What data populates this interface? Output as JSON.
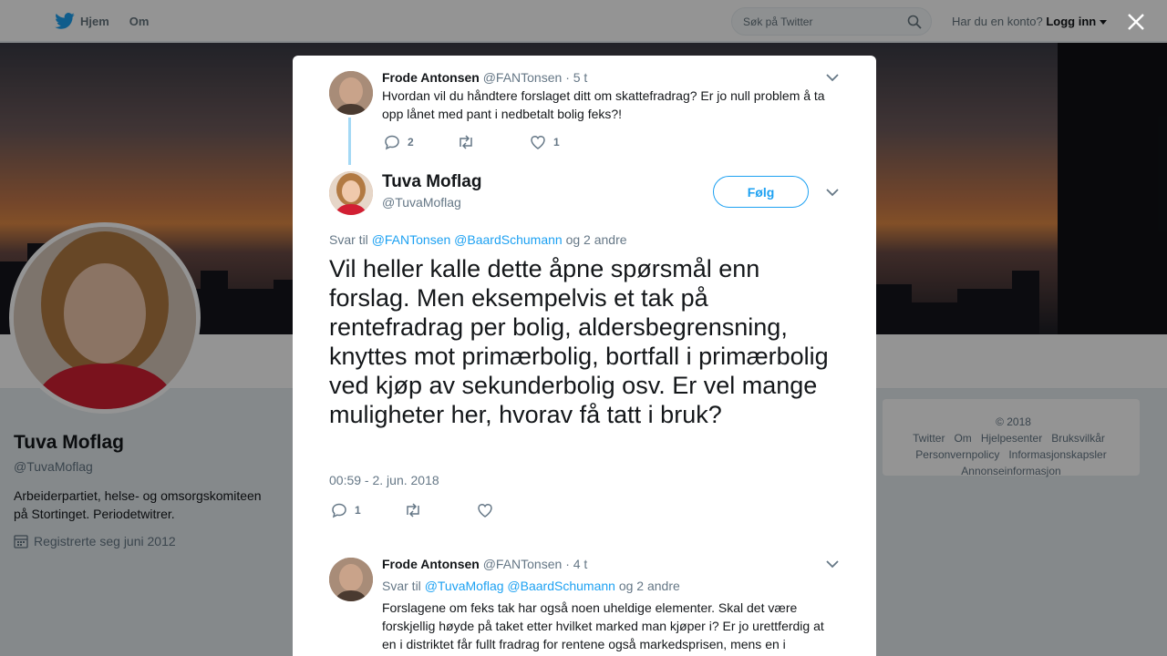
{
  "topbar": {
    "home_label": "Hjem",
    "about_label": "Om",
    "search_placeholder": "Søk på Twitter",
    "account_question": "Har du en konto?",
    "login_label": "Logg inn"
  },
  "profile": {
    "name": "Tuva Moflag",
    "handle": "@TuvaMoflag",
    "bio": "Arbeiderpartiet, helse- og omsorgskomiteen på Stortinget. Periodetwitrer.",
    "joined": "Registrerte seg juni 2012"
  },
  "footer": {
    "links": [
      "© 2018 Twitter",
      "Om",
      "Hjelpesenter",
      "Bruksvilkår",
      "Personvernpolicy",
      "Informasjonskapsler",
      "Annonseinformasjon"
    ]
  },
  "modal": {
    "parent_tweet": {
      "name": "Frode Antonsen",
      "handle": "@FANTonsen",
      "time": "· 5 t",
      "text": "Hvordan vil du håndtere forslaget ditt om skattefradrag? Er jo null problem å ta opp lånet med pant i nedbetalt bolig feks?!",
      "replies": "2",
      "retweets": "",
      "likes": "1"
    },
    "main_tweet": {
      "name": "Tuva Moflag",
      "handle": "@TuvaMoflag",
      "follow_label": "Følg",
      "reply_prefix": "Svar til",
      "reply_to_1": "@FANTonsen",
      "reply_to_2": "@BaardSchumann",
      "reply_others": "og 2 andre",
      "text": "Vil heller kalle dette åpne spørsmål enn forslag. Men eksempelvis et tak på rentefradrag per bolig, aldersbegrensning, knyttes mot primærbolig, bortfall i primærbolig ved kjøp av sekunderbolig osv. Er vel mange muligheter her, hvorav få tatt i bruk?",
      "timestamp": "00:59 - 2. jun. 2018",
      "replies": "1",
      "retweets": "",
      "likes": ""
    },
    "reply_tweet": {
      "name": "Frode Antonsen",
      "handle": "@FANTonsen",
      "time": "· 4 t",
      "reply_prefix": "Svar til",
      "reply_to_1": "@TuvaMoflag",
      "reply_to_2": "@BaardSchumann",
      "reply_others": "og 2 andre",
      "text": "Forslagene om feks tak har også noen uheldige elementer. Skal det være forskjellig høyde på taket etter hvilket marked man kjøper i? Er jo urettferdig at en i distriktet får fullt fradrag for rentene også markedsprisen, mens en i"
    }
  },
  "colors": {
    "accent": "#1da1f2",
    "muted": "#657786",
    "thread_line": "#a4d9f5"
  },
  "icons": [
    "twitter-bird-icon",
    "search-icon",
    "caret-down-icon",
    "close-icon",
    "reply-icon",
    "retweet-icon",
    "heart-icon",
    "calendar-icon"
  ]
}
